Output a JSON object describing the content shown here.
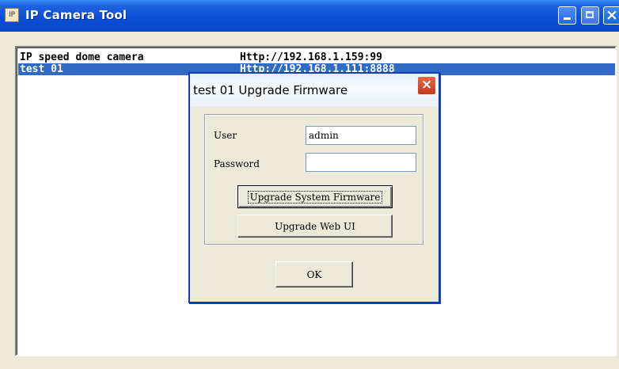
{
  "window": {
    "title": "IP Camera Tool",
    "app_icon_glyph": "IP",
    "buttons": {
      "minimize": "minimize-icon",
      "maximize": "maximize-icon",
      "close": "close-icon"
    }
  },
  "device_list": {
    "rows": [
      {
        "name": "IP speed dome camera",
        "address": "Http://192.168.1.159:99"
      },
      {
        "name": "test 01",
        "address": "Http://192.168.1.111:8888"
      }
    ],
    "selected_index": 1,
    "selection_color": "#316AC5"
  },
  "dialog": {
    "title": "test 01 Upgrade Firmware",
    "close_glyph": "×",
    "user_label": "User",
    "user_value": "admin",
    "password_label": "Password",
    "password_value": "",
    "upgrade_system_label": "Upgrade System Firmware",
    "upgrade_web_label": "Upgrade Web UI",
    "ok_label": "OK"
  }
}
